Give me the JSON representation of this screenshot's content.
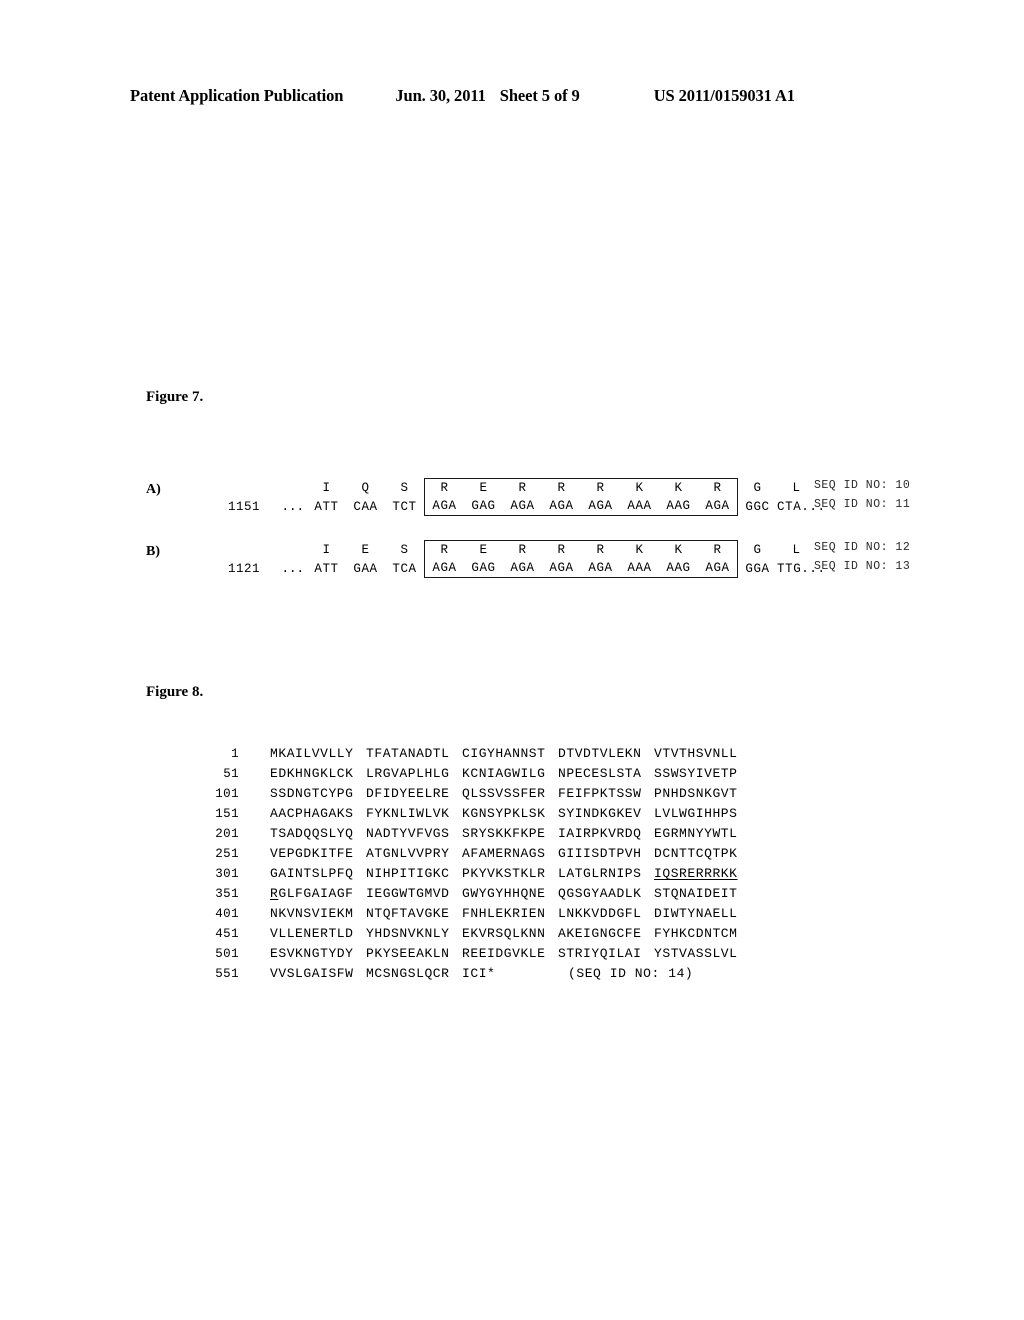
{
  "header": {
    "title": "Patent Application Publication",
    "date": "Jun. 30, 2011",
    "sheet": "Sheet 5 of 9",
    "doc_number": "US 2011/0159031 A1"
  },
  "figure7": {
    "caption": "Figure 7.",
    "panels": [
      {
        "label": "A)",
        "position": "1151",
        "lead_nt": "...",
        "flank_left_aa": [
          "I",
          "Q",
          "S"
        ],
        "flank_left_nt": [
          "ATT",
          "CAA",
          "TCT"
        ],
        "boxed_aa": [
          "R",
          "E",
          "R",
          "R",
          "R",
          "K",
          "K",
          "R"
        ],
        "boxed_nt": [
          "AGA",
          "GAG",
          "AGA",
          "AGA",
          "AGA",
          "AAA",
          "AAG",
          "AGA"
        ],
        "flank_right_aa": [
          "G",
          "L"
        ],
        "flank_right_nt": [
          "GGC",
          "CTA..."
        ],
        "seqid_aa": "SEQ ID NO: 10",
        "seqid_nt": "SEQ ID NO: 11"
      },
      {
        "label": "B)",
        "position": "1121",
        "lead_nt": "...",
        "flank_left_aa": [
          "I",
          "E",
          "S"
        ],
        "flank_left_nt": [
          "ATT",
          "GAA",
          "TCA"
        ],
        "boxed_aa": [
          "R",
          "E",
          "R",
          "R",
          "R",
          "K",
          "K",
          "R"
        ],
        "boxed_nt": [
          "AGA",
          "GAG",
          "AGA",
          "AGA",
          "AGA",
          "AAA",
          "AAG",
          "AGA"
        ],
        "flank_right_aa": [
          "G",
          "L"
        ],
        "flank_right_nt": [
          "GGA",
          "TTG..."
        ],
        "seqid_aa": "SEQ ID NO: 12",
        "seqid_nt": "SEQ ID NO: 13"
      }
    ]
  },
  "figure8": {
    "caption": "Figure 8.",
    "seq_id_label": "(SEQ ID NO: 14)",
    "rows": [
      {
        "num": "1",
        "blocks": [
          "MKAILVVLLY",
          "TFATANADTL",
          "CIGYHANNST",
          "DTVDTVLEKN",
          "VTVTHSVNLL"
        ],
        "underline": []
      },
      {
        "num": "51",
        "blocks": [
          "EDKHNGKLCK",
          "LRGVAPLHLG",
          "KCNIAGWILG",
          "NPECESLSTA",
          "SSWSYIVETP"
        ],
        "underline": []
      },
      {
        "num": "101",
        "blocks": [
          "SSDNGTCYPG",
          "DFIDYEELRE",
          "QLSSVSSFER",
          "FEIFPKTSSW",
          "PNHDSNKGVT"
        ],
        "underline": []
      },
      {
        "num": "151",
        "blocks": [
          "AACPHAGAKS",
          "FYKNLIWLVK",
          "KGNSYPKLSK",
          "SYINDKGKEV",
          "LVLWGIHHPS"
        ],
        "underline": []
      },
      {
        "num": "201",
        "blocks": [
          "TSADQQSLYQ",
          "NADTYVFVGS",
          "SRYSKKFKPE",
          "IAIRPKVRDQ",
          "EGRMNYYWTL"
        ],
        "underline": []
      },
      {
        "num": "251",
        "blocks": [
          "VEPGDKITFE",
          "ATGNLVVPRY",
          "AFAMERNAGS",
          "GIIISDTPVH",
          "DCNTTCQTPK"
        ],
        "underline": []
      },
      {
        "num": "301",
        "blocks": [
          "GAINTSLPFQ",
          "NIHPITIGKC",
          "PKYVKSTKLR",
          "LATGLRNIPS",
          "IQSRERRRKK"
        ],
        "underline": [
          4
        ]
      },
      {
        "num": "351",
        "blocks": [
          "RGLFGAIAGF",
          "IEGGWTGMVD",
          "GWYGYHHQNE",
          "QGSGYAADLK",
          "STQNAIDEIT"
        ],
        "underline": []
      },
      {
        "num": "401",
        "blocks": [
          "NKVNSVIEKM",
          "NTQFTAVGKE",
          "FNHLEKRIEN",
          "LNKKVDDGFL",
          "DIWTYNAELL"
        ],
        "underline": []
      },
      {
        "num": "451",
        "blocks": [
          "VLLENERTLD",
          "YHDSNVKNLY",
          "EKVRSQLKNN",
          "AKEIGNGCFE",
          "FYHKCDNTCM"
        ],
        "underline": []
      },
      {
        "num": "501",
        "blocks": [
          "ESVKNGTYDY",
          "PKYSEEAKLN",
          "REEIDGVKLE",
          "STRIYQILAI",
          "YSTVASSLVL"
        ],
        "underline": []
      },
      {
        "num": "551",
        "blocks": [
          "VVSLGAISFW",
          "MCSNGSLQCR",
          "ICI*"
        ],
        "underline": []
      }
    ]
  }
}
